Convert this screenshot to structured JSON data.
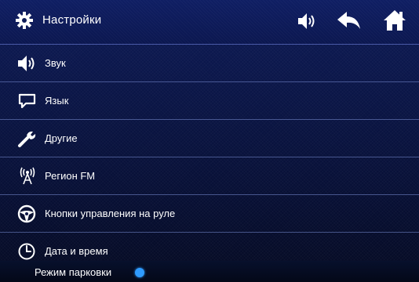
{
  "header": {
    "title": "Настройки",
    "icons": {
      "settings": "gear-icon",
      "volume": "volume-icon",
      "back": "back-arrow-icon",
      "home": "home-icon"
    }
  },
  "menu": {
    "items": [
      {
        "label": "Звук",
        "icon": "speaker-icon"
      },
      {
        "label": "Язык",
        "icon": "speech-bubble-icon"
      },
      {
        "label": "Другие",
        "icon": "wrench-icon"
      },
      {
        "label": "Регион FM",
        "icon": "antenna-icon"
      },
      {
        "label": "Кнопки управления на руле",
        "icon": "steering-wheel-icon"
      },
      {
        "label": "Дата и время",
        "icon": "clock-icon"
      }
    ]
  },
  "parking": {
    "label": "Режим парковки",
    "toggle_color": "#2f9bff"
  },
  "colors": {
    "background": "#0a1546",
    "accent": "#2f9bff",
    "text": "#ffffff"
  }
}
